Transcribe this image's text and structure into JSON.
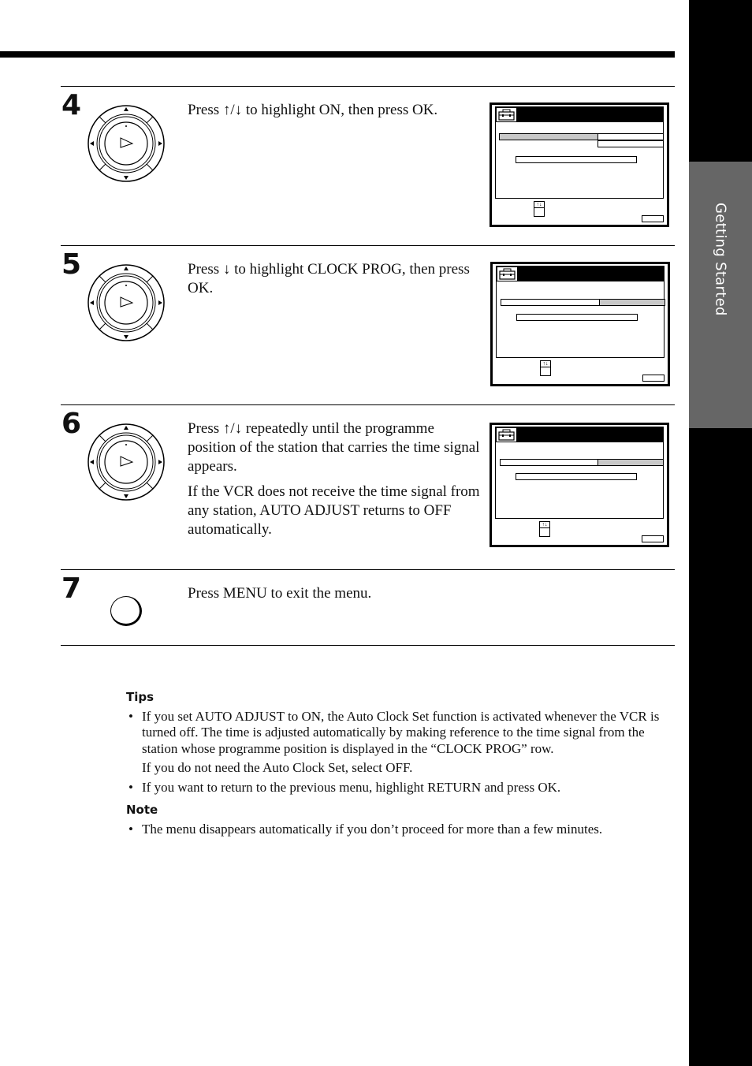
{
  "sidebar": {
    "section_label": "Getting Started"
  },
  "steps": [
    {
      "number": "4",
      "control": "dial",
      "paragraphs": [
        "Press ↑/↓ to highlight ON, then press OK."
      ],
      "screen": {
        "highlight": "left-top",
        "rows": 2
      }
    },
    {
      "number": "5",
      "control": "dial",
      "paragraphs": [
        "Press ↓ to highlight CLOCK PROG, then press OK."
      ],
      "screen": {
        "highlight": "right",
        "rows": 1
      }
    },
    {
      "number": "6",
      "control": "dial",
      "paragraphs": [
        "Press ↑/↓ repeatedly until the programme position of the station that carries the time signal appears.",
        "If the VCR does not receive the time signal from any station, AUTO ADJUST returns to OFF automatically."
      ],
      "screen": {
        "highlight": "right",
        "rows": 1
      }
    },
    {
      "number": "7",
      "control": "menu-button",
      "paragraphs": [
        "Press MENU to exit the menu."
      ]
    }
  ],
  "tips": {
    "heading": "Tips",
    "items": [
      {
        "text": "If you set AUTO ADJUST to ON, the Auto Clock Set function is activated whenever the VCR is turned off. The time is adjusted automatically by making reference to the time signal from the station whose programme position is displayed in the “CLOCK PROG” row.",
        "sub": "If you do not need the Auto Clock Set, select OFF."
      },
      {
        "text": "If you want to return to the previous menu, highlight RETURN and press OK."
      }
    ]
  },
  "note": {
    "heading": "Note",
    "items": [
      {
        "text": "The menu disappears automatically if you don’t proceed for more than a few minutes."
      }
    ]
  }
}
